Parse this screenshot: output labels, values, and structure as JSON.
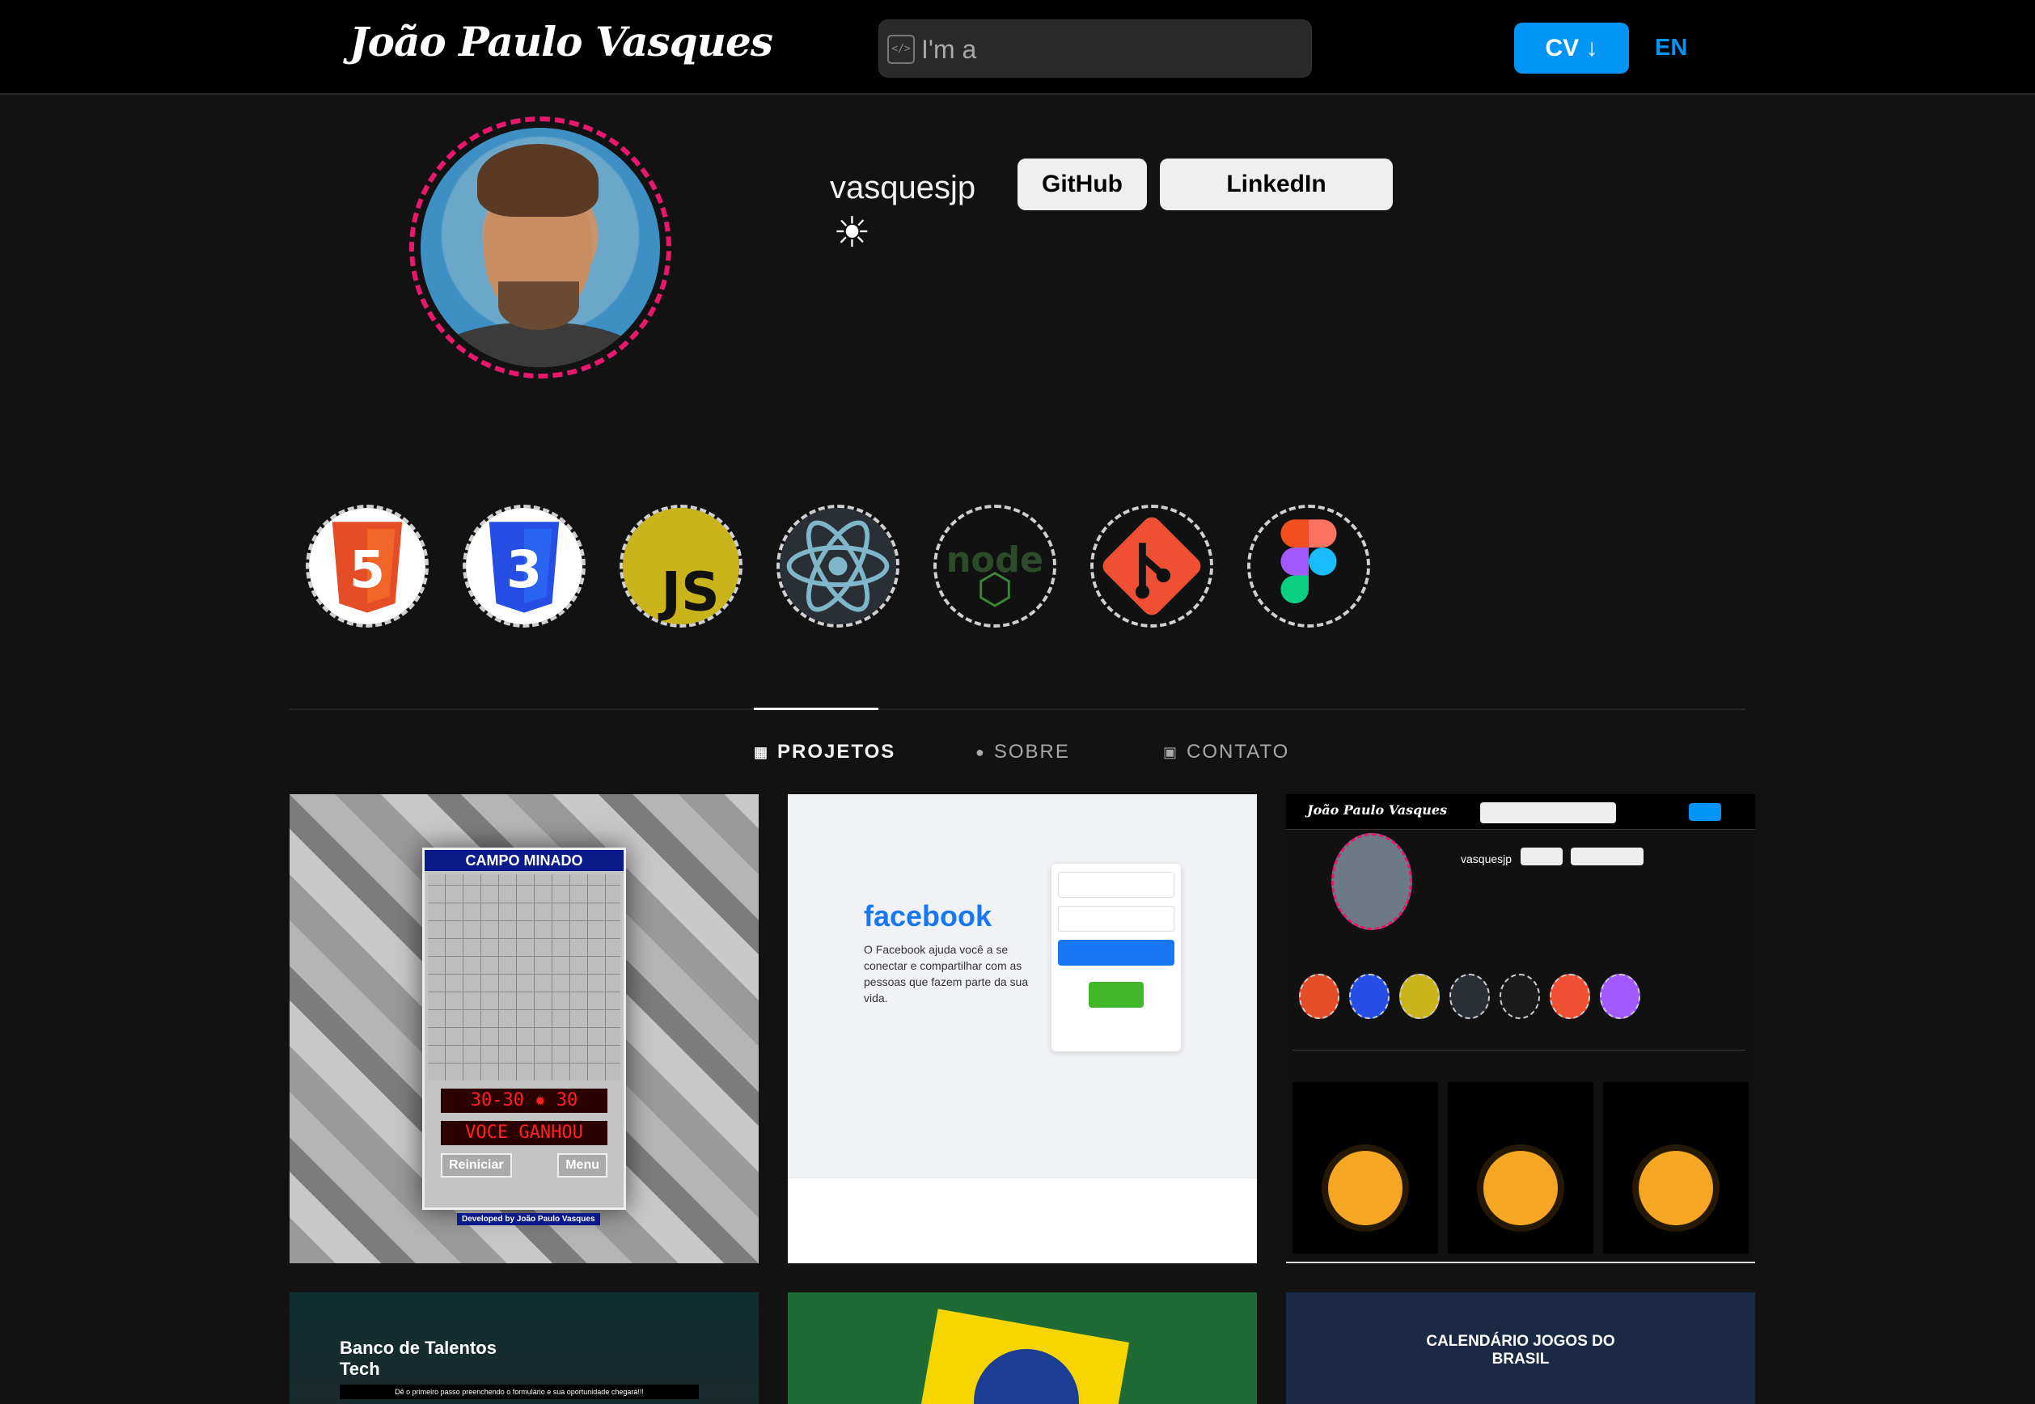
{
  "header": {
    "brand": "João Paulo Vasques",
    "typed_text": "I'm a",
    "cv_label": "CV ↓",
    "lang_label": "EN"
  },
  "profile": {
    "username": "vasquesjp",
    "theme_icon": "sun-icon",
    "github_label": "GitHub",
    "linkedin_label": "LinkedIn",
    "accent_ring": "#e8186d"
  },
  "skills": [
    {
      "name": "html5-icon",
      "color": "#e44d26"
    },
    {
      "name": "css3-icon",
      "color": "#264de4"
    },
    {
      "name": "javascript-icon",
      "color": "#c9b51b"
    },
    {
      "name": "react-icon",
      "color": "#61dafb"
    },
    {
      "name": "nodejs-icon",
      "color": "#3c873a"
    },
    {
      "name": "git-icon",
      "color": "#f05032"
    },
    {
      "name": "figma-icon",
      "color": "#a259ff"
    }
  ],
  "tabs": [
    {
      "label": "PROJETOS",
      "active": true
    },
    {
      "label": "SOBRE",
      "active": false
    },
    {
      "label": "CONTATO",
      "active": false
    }
  ],
  "projects": {
    "minesweeper": {
      "title": "CAMPO MINADO",
      "counter": "30-30 ✹ 30",
      "message": "VOCE GANHOU",
      "restart": "Reiniciar",
      "menu": "Menu",
      "credit": "Developed by João Paulo Vasques"
    },
    "facebook": {
      "logo": "facebook",
      "text": "O Facebook ajuda você a se conectar e compartilhar com as pessoas que fazem parte da sua vida."
    },
    "portfolio": {
      "brand": "João Paulo Vasques",
      "username": "vasquesjp"
    },
    "talents": {
      "title": "Banco de Talentos Tech",
      "subtitle": "Dê o primeiro passo preenchendo o formulário e sua oportunidade chegará!!!"
    },
    "calendar": {
      "title": "CALENDÁRIO JOGOS DO BRASIL"
    }
  },
  "colors": {
    "primary": "#0095f6",
    "background": "#121212",
    "header": "#000000"
  }
}
